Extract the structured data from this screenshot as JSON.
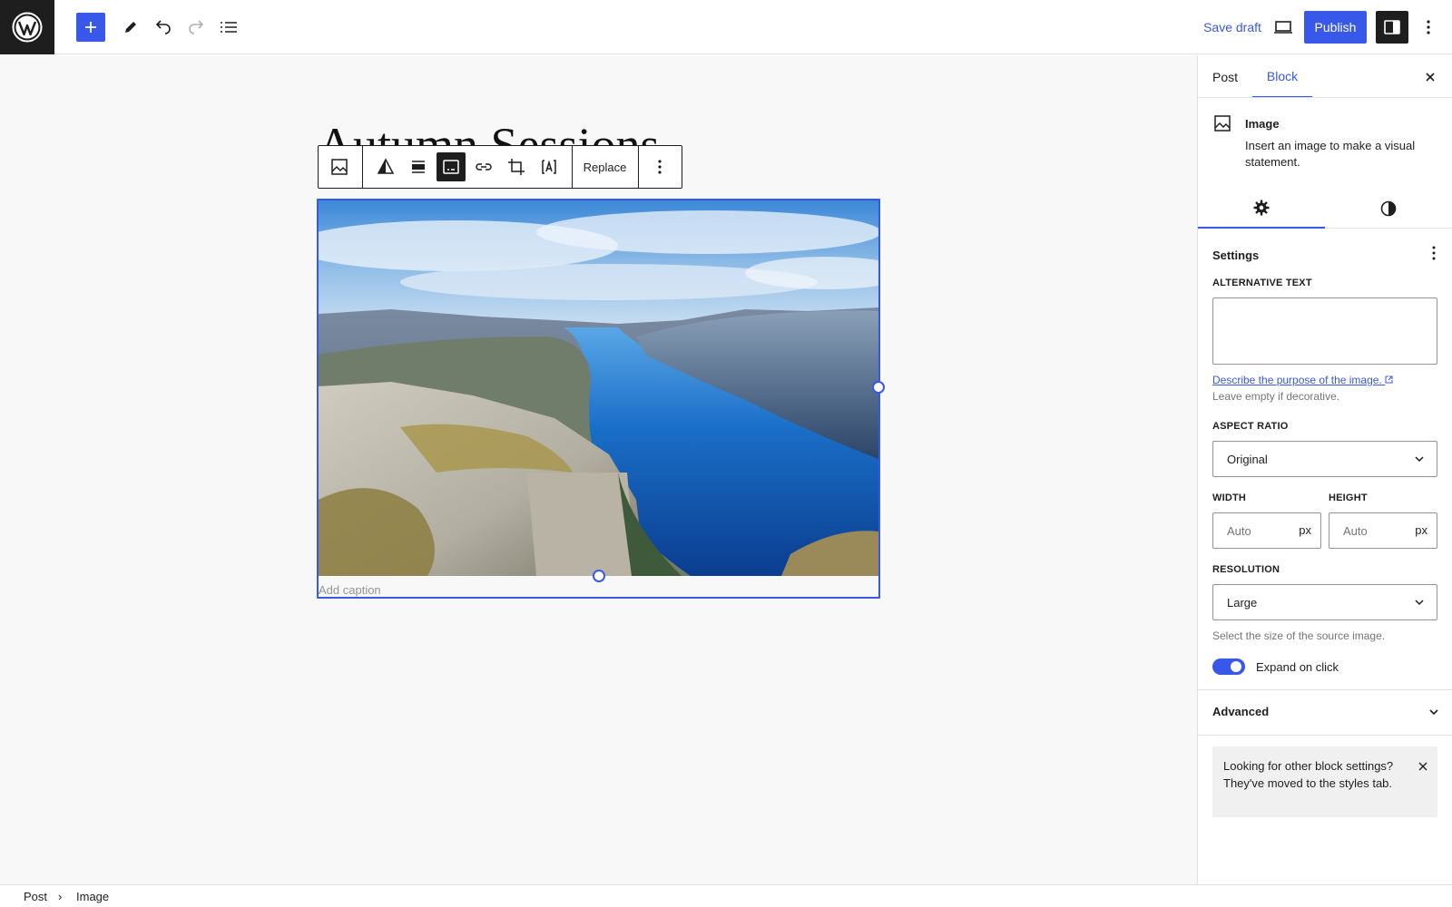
{
  "header": {
    "save_draft_label": "Save draft",
    "publish_label": "Publish",
    "accent_color": "#3858e9"
  },
  "post": {
    "title": "Autumn Sessions"
  },
  "block_toolbar": {
    "replace_label": "Replace",
    "icons": [
      "image-icon",
      "duotone-icon",
      "align-icon",
      "caption-icon",
      "link-icon",
      "crop-icon",
      "text-over-image-icon",
      "more-options-icon"
    ]
  },
  "image_block": {
    "caption_placeholder": "Add caption"
  },
  "breadcrumb": {
    "items": [
      "Post",
      "Image"
    ],
    "separator": "›"
  },
  "sidebar": {
    "tabs": [
      "Post",
      "Block"
    ],
    "active_tab": "Block",
    "block_card": {
      "title": "Image",
      "description": "Insert an image to make a visual statement."
    },
    "settings": {
      "title": "Settings",
      "alt_text_label": "ALTERNATIVE TEXT",
      "alt_text_value": "",
      "alt_link": "Describe the purpose of the image.",
      "alt_help": "Leave empty if decorative.",
      "aspect_ratio_label": "ASPECT RATIO",
      "aspect_ratio_value": "Original",
      "width_label": "WIDTH",
      "height_label": "HEIGHT",
      "width_placeholder": "Auto",
      "height_placeholder": "Auto",
      "unit": "px",
      "resolution_label": "RESOLUTION",
      "resolution_value": "Large",
      "resolution_help": "Select the size of the source image.",
      "expand_label": "Expand on click",
      "expand_on": true
    },
    "advanced_label": "Advanced",
    "notice": "Looking for other block settings? They've moved to the styles tab."
  }
}
